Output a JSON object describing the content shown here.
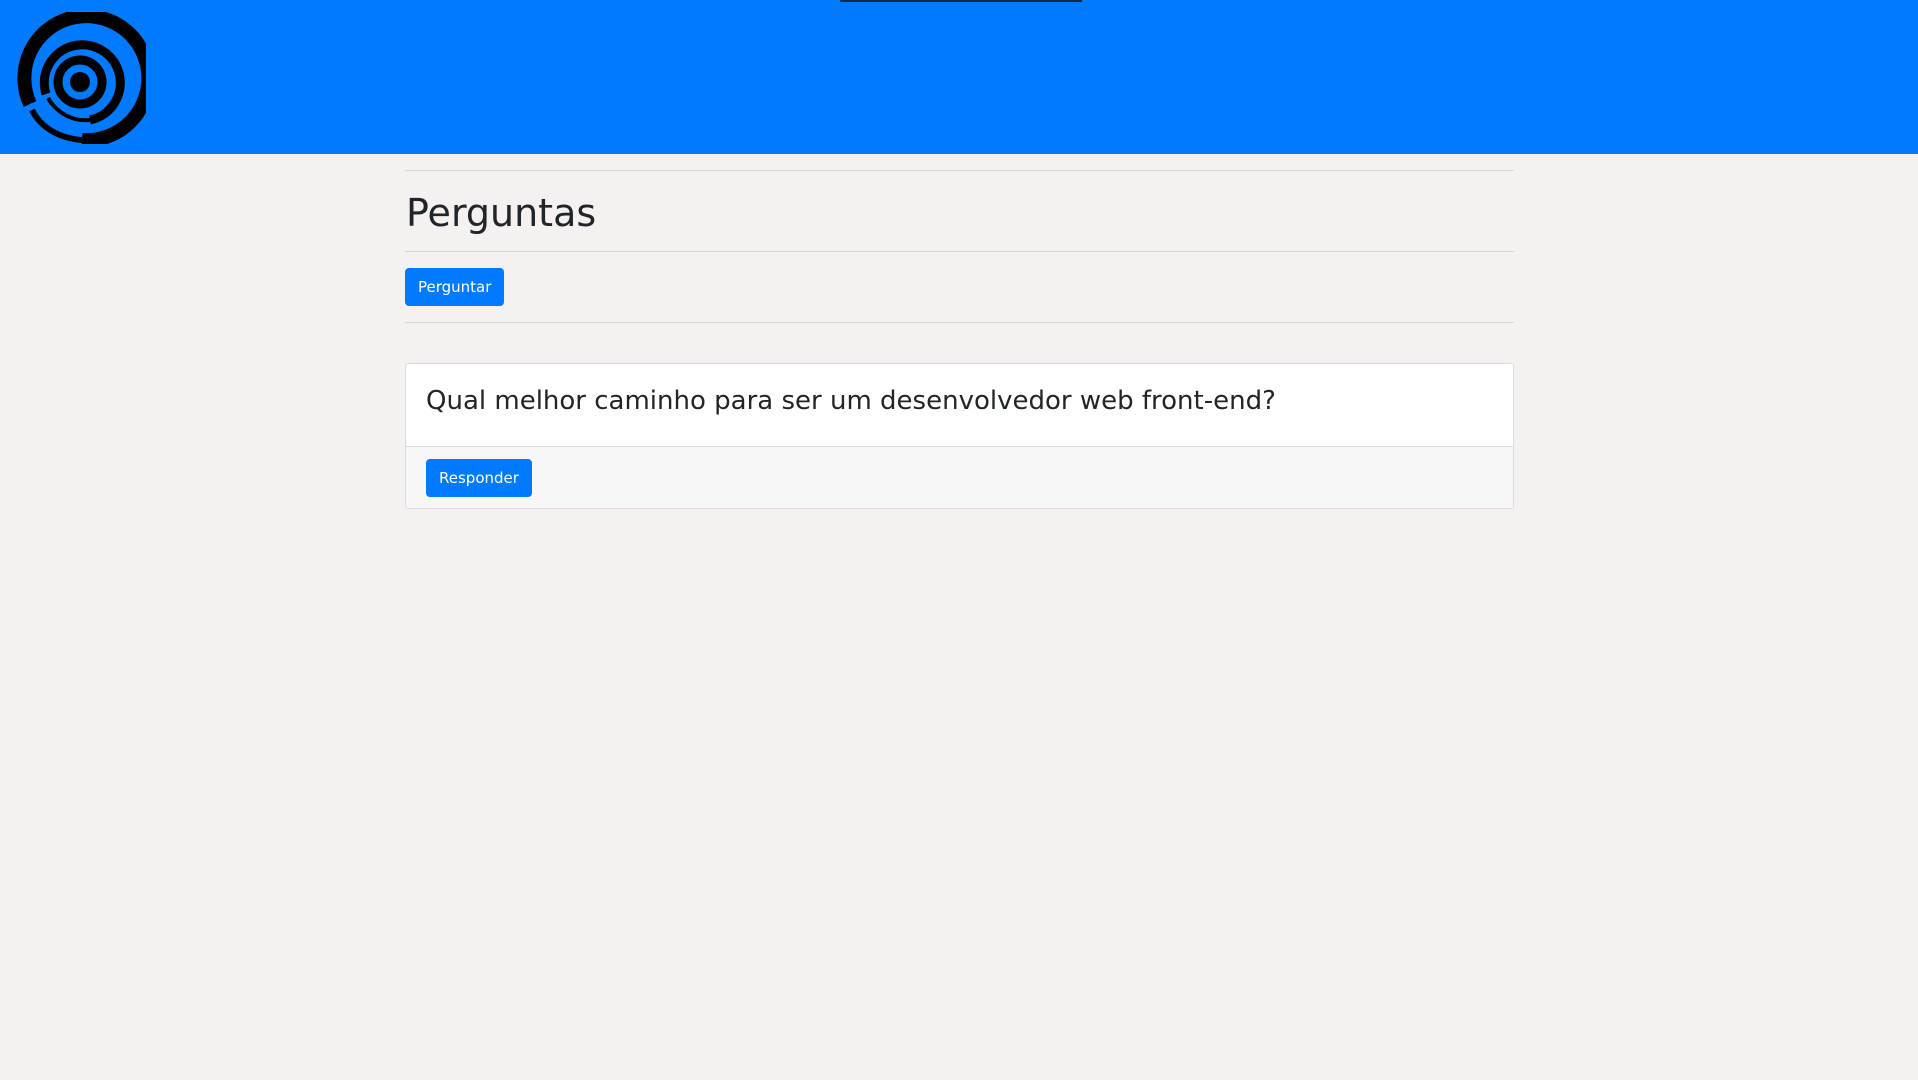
{
  "header": {
    "background_color": "#007bff",
    "logo_icon": "spiral-logo-icon"
  },
  "main": {
    "title": "Perguntas",
    "ask_button_label": "Perguntar",
    "questions": [
      {
        "title": "Qual melhor caminho para ser um desenvolvedor web front-end?",
        "reply_button_label": "Responder"
      }
    ]
  },
  "colors": {
    "accent": "#007bff",
    "page_background": "#f4f1f0",
    "text": "#212529"
  }
}
